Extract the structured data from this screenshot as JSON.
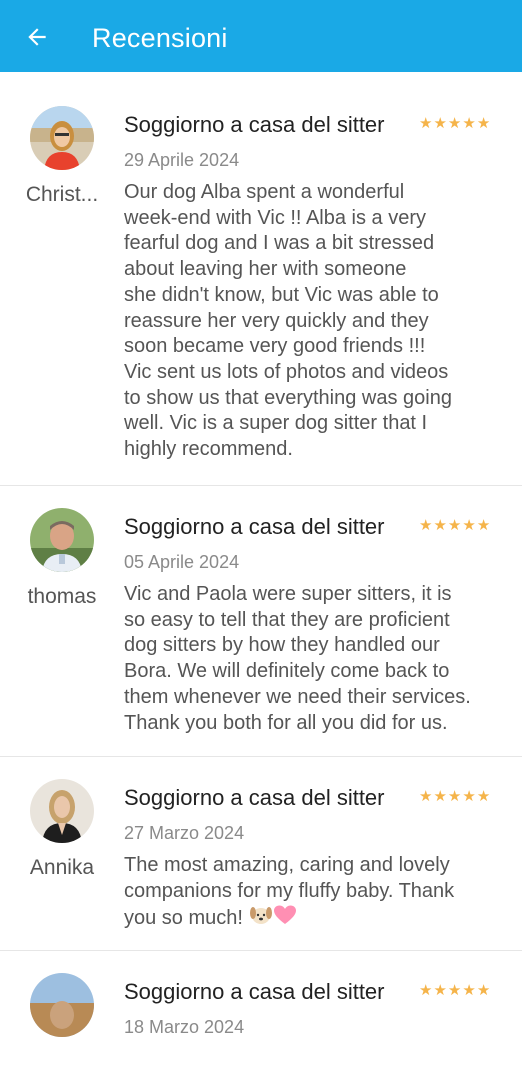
{
  "header": {
    "title": "Recensioni",
    "back_icon": "arrow-left-icon",
    "color": "#1aa9e6"
  },
  "accent": {
    "star_color": "#f5b44a"
  },
  "reviews": [
    {
      "name": "Christ...",
      "title": "Soggiorno a casa del sitter",
      "rating": 5,
      "date": "29 Aprile 2024",
      "lines": [
        "Our dog Alba spent a wonderful",
        "week-end with Vic !! Alba is a very",
        "fearful dog and I was a bit stressed",
        "about leaving her with someone",
        "she didn't know, but Vic was able to",
        "reassure her very quickly and they",
        "soon became very good friends !!!",
        "Vic sent us lots of photos and videos",
        "to show us that everything was going",
        "well. Vic is a super dog sitter that I",
        "highly recommend."
      ]
    },
    {
      "name": "thomas",
      "title": "Soggiorno a casa del sitter",
      "rating": 5,
      "date": "05 Aprile 2024",
      "lines": [
        "Vic and Paola were super sitters, it is",
        "so easy to tell that they are proficient",
        "dog sitters by how they handled our",
        "Bora. We will definitely come back to",
        "them whenever we need their services.",
        "Thank you both for all you did for us."
      ]
    },
    {
      "name": "Annika",
      "title": "Soggiorno a casa del sitter",
      "rating": 5,
      "date": "27 Marzo 2024",
      "lines": [
        "The most amazing, caring and lovely",
        "companions for my fluffy baby. Thank",
        "you so much!"
      ],
      "emojis": [
        "dog-face-emoji",
        "pink-heart-emoji"
      ]
    },
    {
      "name": "",
      "title": "Soggiorno a casa del sitter",
      "rating": 5,
      "date": "18 Marzo 2024",
      "lines": []
    }
  ]
}
